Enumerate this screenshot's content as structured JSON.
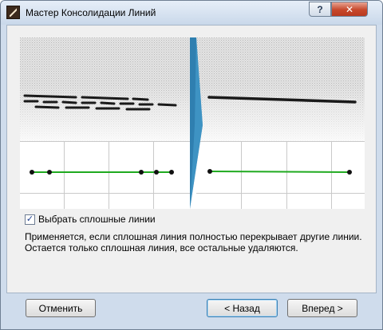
{
  "window": {
    "title": "Мастер Консолидации Линий",
    "help_label": "?",
    "close_label": "✕"
  },
  "options": {
    "solid_lines_label": "Выбрать сплошные линии",
    "solid_lines_checked": true
  },
  "description": {
    "line1": "Применяется, если сплошная линия полностью перекрывает другие линии.",
    "line2": "Остается только сплошная линия, все остальные удаляются."
  },
  "buttons": {
    "cancel_label": "Отменить",
    "back_label": "< Назад",
    "next_label": "Вперед >"
  },
  "colors": {
    "accent_arrow": "#2f7fb0",
    "green_line": "#1faa1f",
    "dashed_line": "#1a1a1a"
  }
}
